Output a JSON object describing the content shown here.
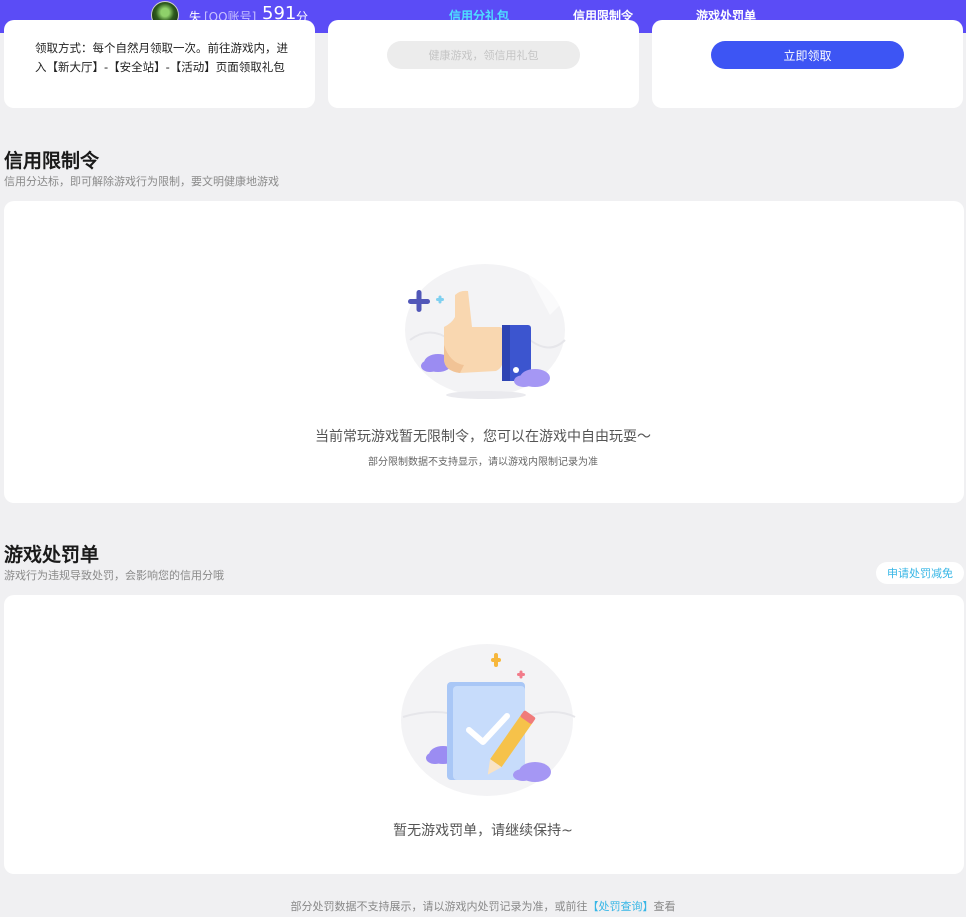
{
  "topbar": {
    "user_name": "失",
    "account_type": "[QQ账号]",
    "score": "591",
    "score_unit": "分",
    "tabs": [
      {
        "label": "信用分礼包"
      },
      {
        "label": "信用限制令"
      },
      {
        "label": "游戏处罚单"
      }
    ]
  },
  "gift_cards": {
    "claim_text": "领取方式：每个自然月领取一次。前往游戏内，进入【新大厅】-【安全站】-【活动】页面领取礼包",
    "disabled_button": "健康游戏，领信用礼包",
    "claim_button": "立即领取"
  },
  "restriction": {
    "title": "信用限制令",
    "subtitle": "信用分达标，即可解除游戏行为限制，要文明健康地游戏",
    "empty_main": "当前常玩游戏暂无限制令，您可以在游戏中自由玩耍～",
    "empty_sub": "部分限制数据不支持显示，请以游戏内限制记录为准"
  },
  "penalty": {
    "title": "游戏处罚单",
    "subtitle": "游戏行为违规导致处罚，会影响您的信用分哦",
    "appeal_button": "申请处罚减免",
    "empty_main": "暂无游戏罚单，请继续保持~",
    "footer_before": "部分处罚数据不支持展示，请以游戏内处罚记录为准，或前往",
    "footer_link": "【处罚查询】",
    "footer_after": "查看"
  },
  "colors": {
    "topbar": "#5b4cf6",
    "active_tab": "#4ee0ff",
    "primary_button": "#3d55f4",
    "link": "#36b6e6"
  }
}
